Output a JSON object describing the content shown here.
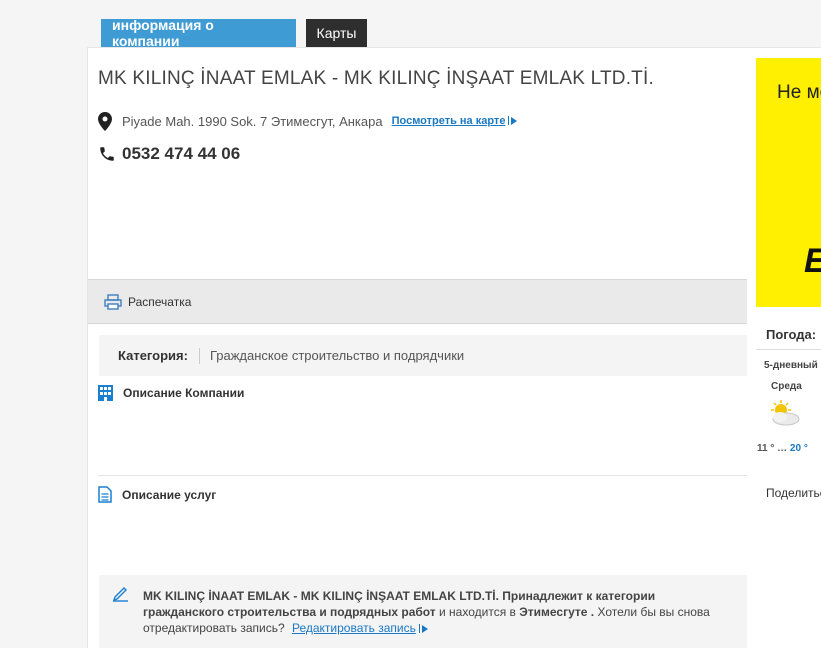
{
  "tabs": {
    "info": "информация о компании",
    "maps": "Карты"
  },
  "company": {
    "title": "MK KILINÇ İNAAT EMLAK - MK KILINÇ İNŞAAT EMLAK LTD.Tİ.",
    "address": "Piyade Mah. 1990 Sok. 7 Этимесгут, Анкара",
    "map_link": "Посмотреть на карте",
    "phone": "0532 474 44 06"
  },
  "print": {
    "label": "Распечатка"
  },
  "category": {
    "label": "Категория:",
    "value": "Гражданское строительство и подрядчики"
  },
  "sections": {
    "description": "Описание Компании",
    "services": "Описание услуг"
  },
  "note": {
    "company": "MK KILINÇ İNAAT EMLAK - MK KILINÇ İNŞAAT EMLAK LTD.Tİ.",
    "text1": " Принадлежит к категории",
    "category": "гражданского строительства и подрядных работ",
    "text2": " и находится в ",
    "location": "Этимесгуте .",
    "text3": " Хотели бы вы снова отредактировать запись?",
    "edit_link": "Редактировать запись"
  },
  "ad": {
    "text": "Не может",
    "big": "E"
  },
  "weather": {
    "title": "Погода:",
    "subtitle": "5-дневный",
    "day": "Среда",
    "low": "11 °",
    "sep": "…",
    "high": "20 °"
  },
  "share": {
    "label": "Поделиться"
  }
}
